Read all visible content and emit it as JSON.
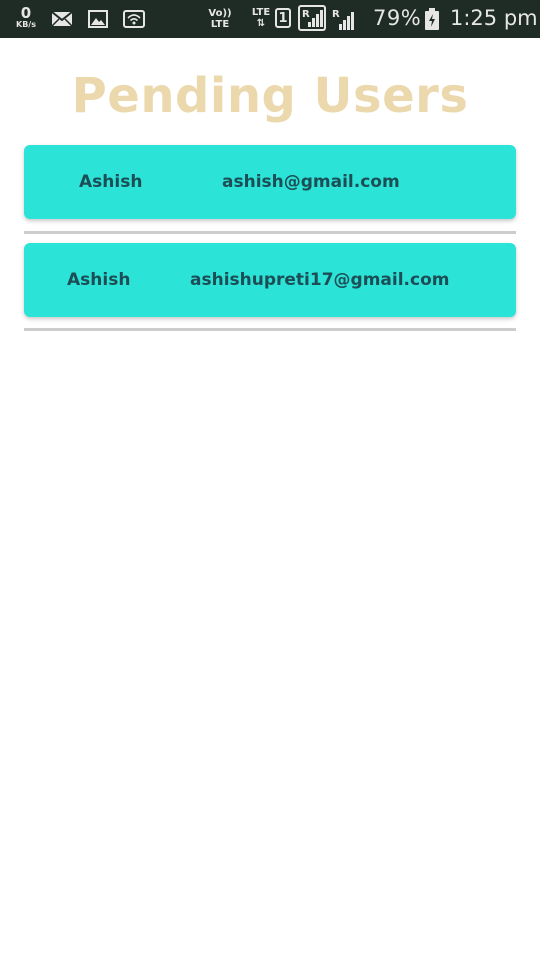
{
  "status_bar": {
    "speed_value": "0",
    "speed_unit": "KB/s",
    "volte_line1": "Vo))",
    "volte_line2": "LTE",
    "lte_label": "LTE",
    "lte_arrows": "⇅",
    "sim_slot": "1",
    "roaming": "R",
    "battery_percent": "79%",
    "time": "1:25 pm",
    "icons": [
      "mail-icon",
      "image-icon",
      "hotspot-icon",
      "signal-icon",
      "battery-charging-icon"
    ]
  },
  "page": {
    "title": "Pending Users"
  },
  "users": [
    {
      "name": "Ashish",
      "email": "ashish@gmail.com"
    },
    {
      "name": "Ashish",
      "email": "ashishupreti17@gmail.com"
    }
  ],
  "colors": {
    "status_bar_bg": "#1f2b25",
    "title": "#ecd8ad",
    "card_bg": "#2be3d7",
    "card_text": "#1d4e56",
    "divider": "#cdcdcd"
  }
}
